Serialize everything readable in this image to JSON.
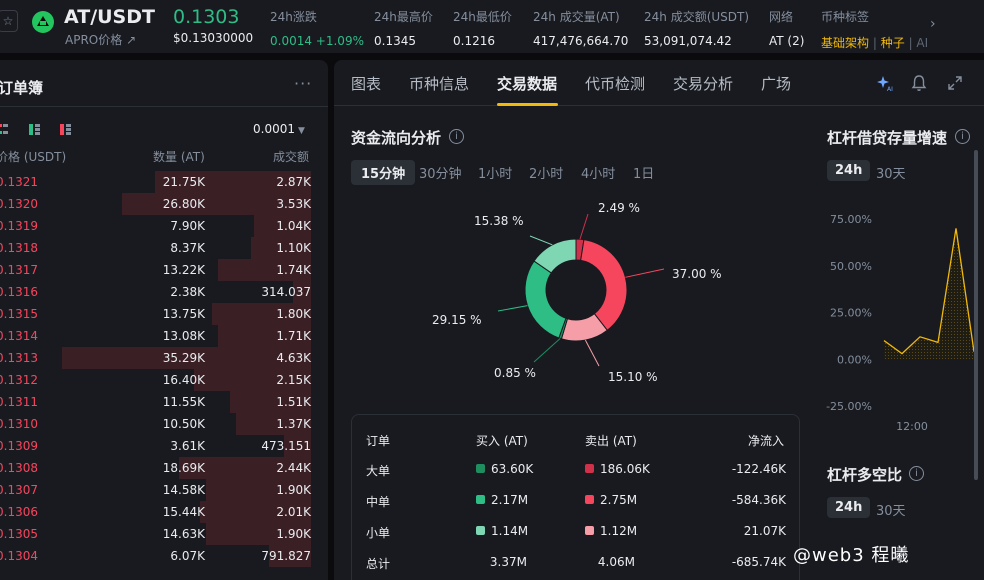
{
  "header": {
    "favorite_icon": "star-icon",
    "pair": "AT/USDT",
    "sub_label": "APRO价格",
    "sub_link_icon": "arrow-up-right-icon",
    "last_price": "0.1303",
    "usd_price": "$0.13030000",
    "stats": [
      {
        "label": "24h涨跌",
        "value": "0.0014 +1.09%"
      },
      {
        "label": "24h最高价",
        "value": "0.1345"
      },
      {
        "label": "24h最低价",
        "value": "0.1216"
      },
      {
        "label": "24h 成交量(AT)",
        "value": "417,476,664.70"
      },
      {
        "label": "24h 成交额(USDT)",
        "value": "53,091,074.42"
      },
      {
        "label": "网络",
        "value": "AT (2)"
      },
      {
        "label": "币种标签",
        "value": "基础架构",
        "value2": "种子",
        "value3": "| AI"
      }
    ],
    "colors": {
      "up": "#2ebd85",
      "down": "#f6465d",
      "tag": "#f0b90b"
    }
  },
  "orderbook": {
    "title": "订单簿",
    "precision": "0.0001",
    "columns": {
      "price": "价格 (USDT)",
      "qty": "数量 (AT)",
      "amount": "成交额"
    },
    "asks": [
      {
        "price": "0.1321",
        "qty": "21.75K",
        "amount": "2.87K",
        "depth": 0.52
      },
      {
        "price": "0.1320",
        "qty": "26.80K",
        "amount": "3.53K",
        "depth": 0.63
      },
      {
        "price": "0.1319",
        "qty": "7.90K",
        "amount": "1.04K",
        "depth": 0.19
      },
      {
        "price": "0.1318",
        "qty": "8.37K",
        "amount": "1.10K",
        "depth": 0.2
      },
      {
        "price": "0.1317",
        "qty": "13.22K",
        "amount": "1.74K",
        "depth": 0.31
      },
      {
        "price": "0.1316",
        "qty": "2.38K",
        "amount": "314.037",
        "depth": 0.06
      },
      {
        "price": "0.1315",
        "qty": "13.75K",
        "amount": "1.80K",
        "depth": 0.33
      },
      {
        "price": "0.1314",
        "qty": "13.08K",
        "amount": "1.71K",
        "depth": 0.31
      },
      {
        "price": "0.1313",
        "qty": "35.29K",
        "amount": "4.63K",
        "depth": 0.83
      },
      {
        "price": "0.1312",
        "qty": "16.40K",
        "amount": "2.15K",
        "depth": 0.39
      },
      {
        "price": "0.1311",
        "qty": "11.55K",
        "amount": "1.51K",
        "depth": 0.27
      },
      {
        "price": "0.1310",
        "qty": "10.50K",
        "amount": "1.37K",
        "depth": 0.25
      },
      {
        "price": "0.1309",
        "qty": "3.61K",
        "amount": "473.151",
        "depth": 0.09
      },
      {
        "price": "0.1308",
        "qty": "18.69K",
        "amount": "2.44K",
        "depth": 0.44
      },
      {
        "price": "0.1307",
        "qty": "14.58K",
        "amount": "1.90K",
        "depth": 0.35
      },
      {
        "price": "0.1306",
        "qty": "15.44K",
        "amount": "2.01K",
        "depth": 0.37
      },
      {
        "price": "0.1305",
        "qty": "14.63K",
        "amount": "1.90K",
        "depth": 0.35
      },
      {
        "price": "0.1304",
        "qty": "6.07K",
        "amount": "791.827",
        "depth": 0.14
      }
    ]
  },
  "tabs": [
    "图表",
    "币种信息",
    "交易数据",
    "代币检测",
    "交易分析",
    "广场"
  ],
  "active_tab": "交易数据",
  "toolbar_icons": [
    "ai-sparkle-icon",
    "bell-icon",
    "expand-icon"
  ],
  "money_flow": {
    "title": "资金流向分析",
    "intervals": [
      "15分钟",
      "30分钟",
      "1小时",
      "2小时",
      "4小时",
      "1日"
    ],
    "active_interval": "15分钟",
    "table": {
      "headers": [
        "订单",
        "买入 (AT)",
        "卖出 (AT)",
        "净流入"
      ],
      "rows": [
        {
          "label": "大单",
          "buy": "63.60K",
          "sell": "186.06K",
          "net": "-122.46K",
          "buy_color": "#1e8e5e",
          "sell_color": "#cf304a"
        },
        {
          "label": "中单",
          "buy": "2.17M",
          "sell": "2.75M",
          "net": "-584.36K",
          "buy_color": "#2ebd85",
          "sell_color": "#f6465d"
        },
        {
          "label": "小单",
          "buy": "1.14M",
          "sell": "1.12M",
          "net": "21.07K",
          "buy_color": "#7fd6b2",
          "sell_color": "#f59ea8"
        },
        {
          "label": "总计",
          "buy": "3.37M",
          "sell": "4.06M",
          "net": "-685.74K"
        }
      ]
    }
  },
  "chart_data": [
    {
      "type": "pie",
      "title": "资金流向分析",
      "slices": [
        {
          "label": "2.49 %",
          "value": 2.49,
          "color": "#cf304a"
        },
        {
          "label": "37.00 %",
          "value": 37.0,
          "color": "#f6465d"
        },
        {
          "label": "15.10 %",
          "value": 15.1,
          "color": "#f59ea8"
        },
        {
          "label": "0.85 %",
          "value": 0.85,
          "color": "#1e8e5e"
        },
        {
          "label": "29.15 %",
          "value": 29.15,
          "color": "#2ebd85"
        },
        {
          "label": "15.38 %",
          "value": 15.38,
          "color": "#7fd6b2"
        }
      ]
    },
    {
      "type": "line",
      "title": "杠杆借贷存量增速",
      "y_ticks": [
        "75.00%",
        "50.00%",
        "25.00%",
        "0.00%",
        "-25.00%"
      ],
      "ylim": [
        -25,
        75
      ],
      "x_ticks": [
        "12:00"
      ],
      "series": [
        {
          "values": [
            10,
            3,
            12,
            9,
            70,
            4
          ],
          "color": "#f0b90b"
        }
      ]
    }
  ],
  "leverage": {
    "growth_title": "杠杆借贷存量增速",
    "growth_periods": [
      "24h",
      "30天"
    ],
    "ratio_title": "杠杆多空比",
    "ratio_periods": [
      "24h",
      "30天"
    ]
  },
  "watermark": "@web3  程曦"
}
